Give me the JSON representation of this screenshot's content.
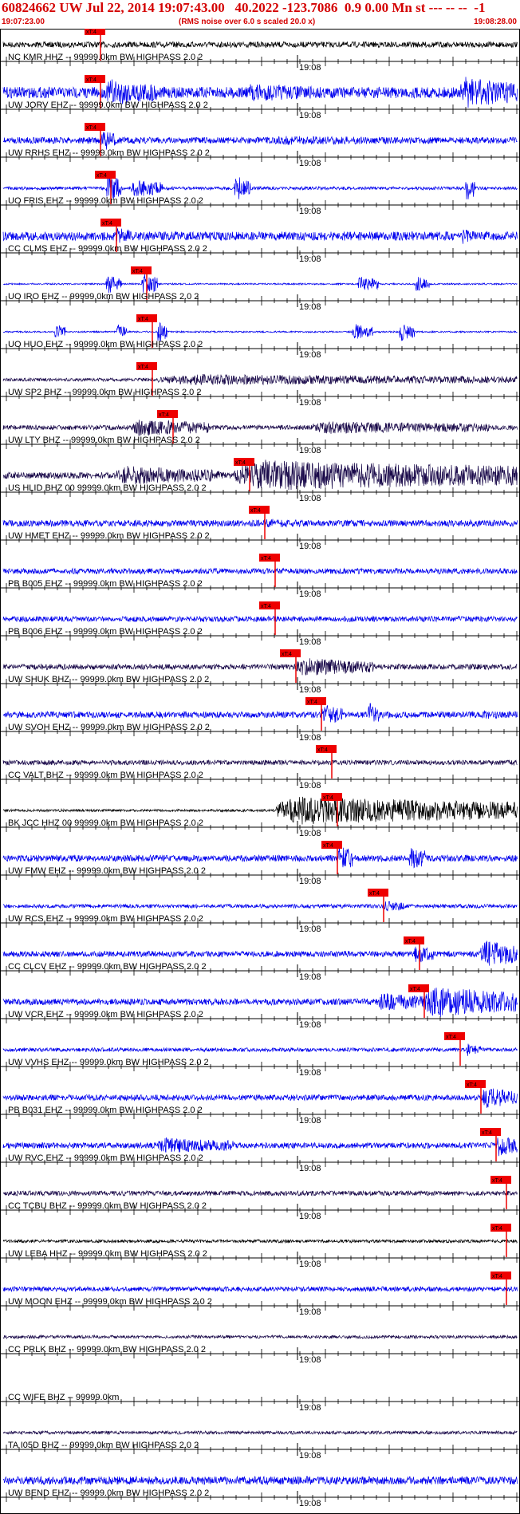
{
  "header": {
    "title": "60824662 UW Jul 22, 2014 19:07:43.00   40.2022 -123.7086  0.9 0.00 Mn st --- -- --  -1",
    "start_time": "19:07:23.00",
    "rms_note": "(RMS noise over 6.0 s scaled 20.0 x)",
    "end_time": "19:08:28.00"
  },
  "colors": {
    "header_text": "#d40000",
    "pick": "#ee0000",
    "blue": "#0000ee",
    "dark": "#1a0a4a",
    "black": "#000000"
  },
  "chart_data": {
    "type": "seismogram",
    "x_range": [
      "19:07:23.00",
      "19:08:28.00"
    ],
    "time_label": "19:08",
    "pick_label": "xT:4",
    "traces": [
      {
        "label": "NC KMR HHZ -- 99999.0km BW  HIGHPASS  2.0  2",
        "color": "black",
        "amp": 0.18,
        "pick": 0.19,
        "events": []
      },
      {
        "label": "UW JORV EHZ -- 99999.0km BW  HIGHPASS  2.0  2",
        "color": "blue",
        "amp": 0.35,
        "pick": 0.19,
        "events": [
          [
            0.2,
            0.3,
            0.9
          ],
          [
            0.47,
            0.62,
            0.6
          ],
          [
            0.89,
            1.0,
            1.0
          ]
        ]
      },
      {
        "label": "UW RRHS EHZ -- 99999.0km BW  HIGHPASS  2.0  2",
        "color": "blue",
        "amp": 0.2,
        "pick": 0.19,
        "events": [
          [
            0.19,
            0.22,
            0.7
          ],
          [
            0.5,
            1.0,
            0.28
          ]
        ]
      },
      {
        "label": "UO FRIS EHZ -- 99999.0km BW  HIGHPASS  2.0  2",
        "color": "blue",
        "amp": 0.1,
        "pick": 0.21,
        "events": [
          [
            0.2,
            0.23,
            0.9
          ],
          [
            0.25,
            0.31,
            0.6
          ],
          [
            0.45,
            0.48,
            0.8
          ],
          [
            0.9,
            0.92,
            0.8
          ]
        ]
      },
      {
        "label": "CC CLMS EHZ -- 99999.0km BW  HIGHPASS  2.0  2",
        "color": "blue",
        "amp": 0.28,
        "pick": 0.22,
        "events": [
          [
            0.22,
            0.25,
            0.6
          ],
          [
            0.89,
            0.93,
            0.5
          ]
        ]
      },
      {
        "label": "UO IRO EHZ -- 99999.0km BW  HIGHPASS  2.0  2",
        "color": "blue",
        "amp": 0.05,
        "pick": 0.28,
        "events": [
          [
            0.2,
            0.23,
            0.6
          ],
          [
            0.27,
            0.3,
            0.7
          ],
          [
            0.69,
            0.73,
            0.5
          ],
          [
            0.8,
            0.83,
            0.5
          ]
        ]
      },
      {
        "label": "UO HUO EHZ -- 99999.0km BW  HIGHPASS  2.0  2",
        "color": "blue",
        "amp": 0.05,
        "pick": 0.29,
        "events": [
          [
            0.1,
            0.12,
            0.5
          ],
          [
            0.22,
            0.24,
            0.6
          ],
          [
            0.3,
            0.32,
            0.7
          ],
          [
            0.68,
            0.72,
            0.5
          ],
          [
            0.77,
            0.8,
            0.6
          ]
        ]
      },
      {
        "label": "UW SP2 BHZ -- 99999.0km BW  HIGHPASS  2.0  2",
        "color": "dark",
        "amp": 0.1,
        "pick": 0.29,
        "events": [
          [
            0.3,
            1.0,
            0.35
          ]
        ]
      },
      {
        "label": "UW LTY BHZ -- 99999.0km BW  HIGHPASS  2.0  2",
        "color": "dark",
        "amp": 0.15,
        "pick": 0.33,
        "events": [
          [
            0.25,
            0.4,
            0.55
          ],
          [
            0.6,
            0.95,
            0.4
          ]
        ]
      },
      {
        "label": "US HLID BHZ 00 99999.0km BW  HIGHPASS  2.0  2",
        "color": "dark",
        "amp": 0.2,
        "pick": 0.48,
        "events": [
          [
            0.22,
            0.42,
            0.6
          ],
          [
            0.45,
            1.0,
            1.0
          ]
        ]
      },
      {
        "label": "UW HMET EHZ -- 99999.0km BW  HIGHPASS  2.0  2",
        "color": "blue",
        "amp": 0.2,
        "pick": 0.51,
        "events": [
          [
            0.5,
            0.6,
            0.3
          ]
        ]
      },
      {
        "label": "PB B005 EHZ -- 99999.0km BW  HIGHPASS  2.0  2",
        "color": "blue",
        "amp": 0.17,
        "pick": 0.53,
        "events": []
      },
      {
        "label": "PB B006 EHZ -- 99999.0km BW  HIGHPASS  2.0  2",
        "color": "blue",
        "amp": 0.17,
        "pick": 0.53,
        "events": []
      },
      {
        "label": "UW SHUK BHZ -- 99999.0km BW  HIGHPASS  2.0  2",
        "color": "dark",
        "amp": 0.17,
        "pick": 0.57,
        "events": [
          [
            0.57,
            0.72,
            0.6
          ]
        ]
      },
      {
        "label": "UW SVOH EHZ -- 99999.0km BW  HIGHPASS  2.0  2",
        "color": "blue",
        "amp": 0.2,
        "pick": 0.62,
        "events": [
          [
            0.62,
            0.66,
            0.7
          ],
          [
            0.71,
            0.73,
            0.8
          ],
          [
            0.93,
            0.99,
            0.3
          ]
        ]
      },
      {
        "label": "CC VALT BHZ -- 99999.0km BW  HIGHPASS  2.0  2",
        "color": "dark",
        "amp": 0.15,
        "pick": 0.64,
        "events": []
      },
      {
        "label": "BK JCC HHZ 00 99999.0km BW  HIGHPASS  2.0  2",
        "color": "black",
        "amp": 0.08,
        "pick": 0.65,
        "events": [
          [
            0.53,
            1.0,
            0.9
          ]
        ]
      },
      {
        "label": "UW FMW EHZ -- 99999.0km BW  HIGHPASS  2.0  2",
        "color": "blue",
        "amp": 0.2,
        "pick": 0.65,
        "events": [
          [
            0.65,
            0.68,
            0.9
          ],
          [
            0.79,
            0.82,
            0.8
          ]
        ]
      },
      {
        "label": "UW RCS EHZ -- 99999.0km BW  HIGHPASS  2.0  2",
        "color": "blue",
        "amp": 0.12,
        "pick": 0.74,
        "events": [
          [
            0.74,
            0.78,
            0.4
          ]
        ]
      },
      {
        "label": "CC CLCV EHZ -- 99999.0km BW  HIGHPASS  2.0  2",
        "color": "blue",
        "amp": 0.18,
        "pick": 0.81,
        "events": [
          [
            0.8,
            0.84,
            0.6
          ],
          [
            0.93,
            1.0,
            0.9
          ]
        ]
      },
      {
        "label": "UW VCR EHZ -- 99999.0km BW  HIGHPASS  2.0  2",
        "color": "blue",
        "amp": 0.2,
        "pick": 0.82,
        "events": [
          [
            0.73,
            0.82,
            0.6
          ],
          [
            0.82,
            1.0,
            1.0
          ]
        ]
      },
      {
        "label": "UW VVHS EHZ -- 99999.0km BW  HIGHPASS  2.0  2",
        "color": "blue",
        "amp": 0.12,
        "pick": 0.89,
        "events": [
          [
            0.9,
            0.93,
            0.4
          ]
        ]
      },
      {
        "label": "PB B031 EHZ -- 99999.0km BW  HIGHPASS  2.0  2",
        "color": "blue",
        "amp": 0.18,
        "pick": 0.93,
        "events": [
          [
            0.93,
            1.0,
            0.7
          ]
        ]
      },
      {
        "label": "UW RVC EHZ -- 99999.0km BW  HIGHPASS  2.0  2",
        "color": "blue",
        "amp": 0.18,
        "pick": 0.96,
        "events": [
          [
            0.3,
            0.45,
            0.5
          ],
          [
            0.96,
            1.0,
            0.7
          ]
        ]
      },
      {
        "label": "CC TCBU BHZ -- 99999.0km BW  HIGHPASS  2.0  2",
        "color": "dark",
        "amp": 0.15,
        "pick": 0.98,
        "events": []
      },
      {
        "label": "UW LEBA HHZ -- 99999.0km BW  HIGHPASS  2.0  2",
        "color": "black",
        "amp": 0.1,
        "pick": 0.98,
        "events": []
      },
      {
        "label": "UW MOON EHZ -- 99999.0km BW  HIGHPASS  2.0  2",
        "color": "blue",
        "amp": 0.15,
        "pick": 0.98,
        "events": []
      },
      {
        "label": "CC PRLK BHZ -- 99999.0km BW  HIGHPASS  2.0  2",
        "color": "dark",
        "amp": 0.1,
        "pick": null,
        "events": []
      },
      {
        "label": "CC WIFE BHZ -- 99999.0km",
        "color": "dark",
        "amp": 0.0,
        "pick": null,
        "events": []
      },
      {
        "label": "TA I05D BHZ -- 99999.0km BW  HIGHPASS  2.0  2",
        "color": "dark",
        "amp": 0.1,
        "pick": null,
        "events": []
      },
      {
        "label": "UW BEND EHZ -- 99999.0km BW  HIGHPASS  2.0  2",
        "color": "blue",
        "amp": 0.25,
        "pick": null,
        "events": []
      }
    ]
  }
}
